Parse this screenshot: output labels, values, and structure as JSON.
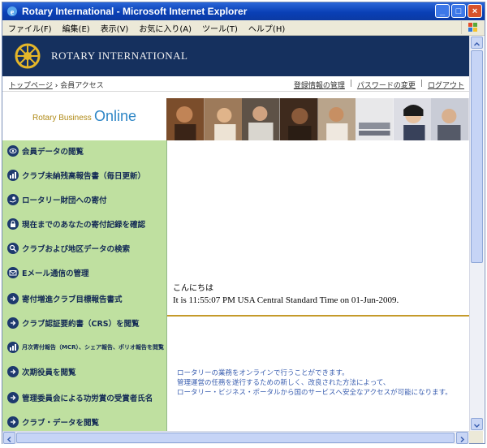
{
  "window": {
    "title": "Rotary International - Microsoft Internet Explorer",
    "min_label": "_",
    "max_label": "□",
    "close_label": "×"
  },
  "menu": [
    "ファイル(F)",
    "編集(E)",
    "表示(V)",
    "お気に入り(A)",
    "ツール(T)",
    "ヘルプ(H)"
  ],
  "header": {
    "org_name": "ROTARY INTERNATIONAL"
  },
  "breadcrumb": {
    "home": "トップページ",
    "sep": "›",
    "current": "会員アクセス"
  },
  "top_links": {
    "account": "登録情報の管理",
    "password": "パスワードの変更",
    "logout": "ログアウト",
    "divider": "|"
  },
  "brand": {
    "rotary_business": "Rotary Business",
    "online": "Online"
  },
  "sidebar": {
    "items": [
      {
        "label": "会員データの閲覧",
        "icon": "eye-icon"
      },
      {
        "label": "クラブ未納残高報告書（毎日更新）",
        "icon": "bar-chart-icon"
      },
      {
        "label": "ロータリー財団への寄付",
        "icon": "hand-coin-icon"
      },
      {
        "label": "現在までのあなたの寄付記録を確認",
        "icon": "lock-icon"
      },
      {
        "label": "クラブおよび地区データの検索",
        "icon": "magnifier-icon"
      },
      {
        "label": "Eメール通信の管理",
        "icon": "envelope-icon"
      },
      {
        "label": "寄付増進クラブ目標報告書式",
        "icon": "arrow-icon"
      },
      {
        "label": "クラブ認証要約書（CRS）を閲覧",
        "icon": "arrow-icon"
      },
      {
        "label": "月次寄付報告（MCR）、シェア報告、ポリオ報告を閲覧",
        "icon": "bar-chart-icon"
      },
      {
        "label": "次期役員を閲覧",
        "icon": "arrow-icon"
      },
      {
        "label": "管理委員会による功労賞の受賞者氏名",
        "icon": "arrow-icon"
      },
      {
        "label": "クラブ・データを閲覧",
        "icon": "arrow-icon"
      }
    ]
  },
  "main": {
    "greeting": "こんにちは",
    "time_line": "It is 11:55:07 PM USA Central Standard Time on 01-Jun-2009.",
    "info_lines": [
      "ロータリーの業務をオンラインで行うことができます。",
      "管理運営の任務を遂行するための新しく、改良された方法によって、",
      "ロータリー・ビジネス・ポータルから国のサービスへ安全なアクセスが可能になります。"
    ]
  },
  "colors": {
    "header_bg": "#15305e",
    "sidebar_bg": "#bfe0a0",
    "divider_gold": "#c59a2a",
    "info_text": "#3b5fb0"
  }
}
